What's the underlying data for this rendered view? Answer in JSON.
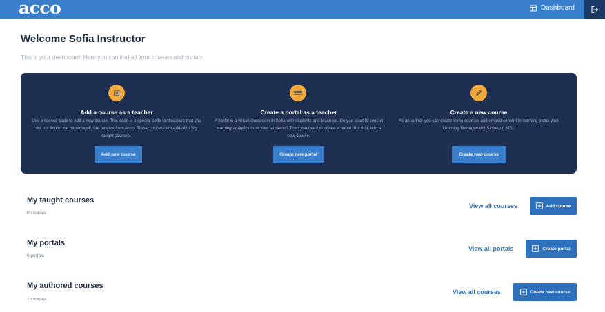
{
  "header": {
    "logo": "acco",
    "dashboard_label": "Dashboard"
  },
  "welcome": {
    "title": "Welcome Sofia Instructor",
    "subtitle": "This is your dashboard. Here you can find all your courses and portals."
  },
  "promo": {
    "items": [
      {
        "icon": "book-icon",
        "title": "Add a course as a teacher",
        "description": "Use a licence code to add a new course. This code is a special code for teachers that you will not find in the paper book, but receive from Acco. These courses are added to 'My taught courses'.",
        "button": "Add new course"
      },
      {
        "icon": "group-icon",
        "title": "Create a portal as a teacher",
        "description": "A portal is a virtual classroom in Sofia with students and teachers. Do you want to consult learning analytics from your students? Then you need to create a portal. But first, add a new course.",
        "button": "Create new portal"
      },
      {
        "icon": "pencil-icon",
        "title": "Create a new course",
        "description": "As an author you can create Sofia courses and embed content in learning paths your Learning Management System (LMS).",
        "button": "Create new course"
      }
    ]
  },
  "sections": [
    {
      "title": "My taught courses",
      "count": "0 courses",
      "view_all": "View all courses",
      "button": "Add course"
    },
    {
      "title": "My portals",
      "count": "0 portals",
      "view_all": "View all portals",
      "button": "Create portal"
    },
    {
      "title": "My authored courses",
      "count": "1 courses",
      "view_all": "View all courses",
      "button": "Create new course"
    }
  ],
  "colors": {
    "topbar": "#3a7fcb",
    "promo_bg": "#1e2f52",
    "accent": "#f2a93b",
    "button": "#2f70bd"
  }
}
